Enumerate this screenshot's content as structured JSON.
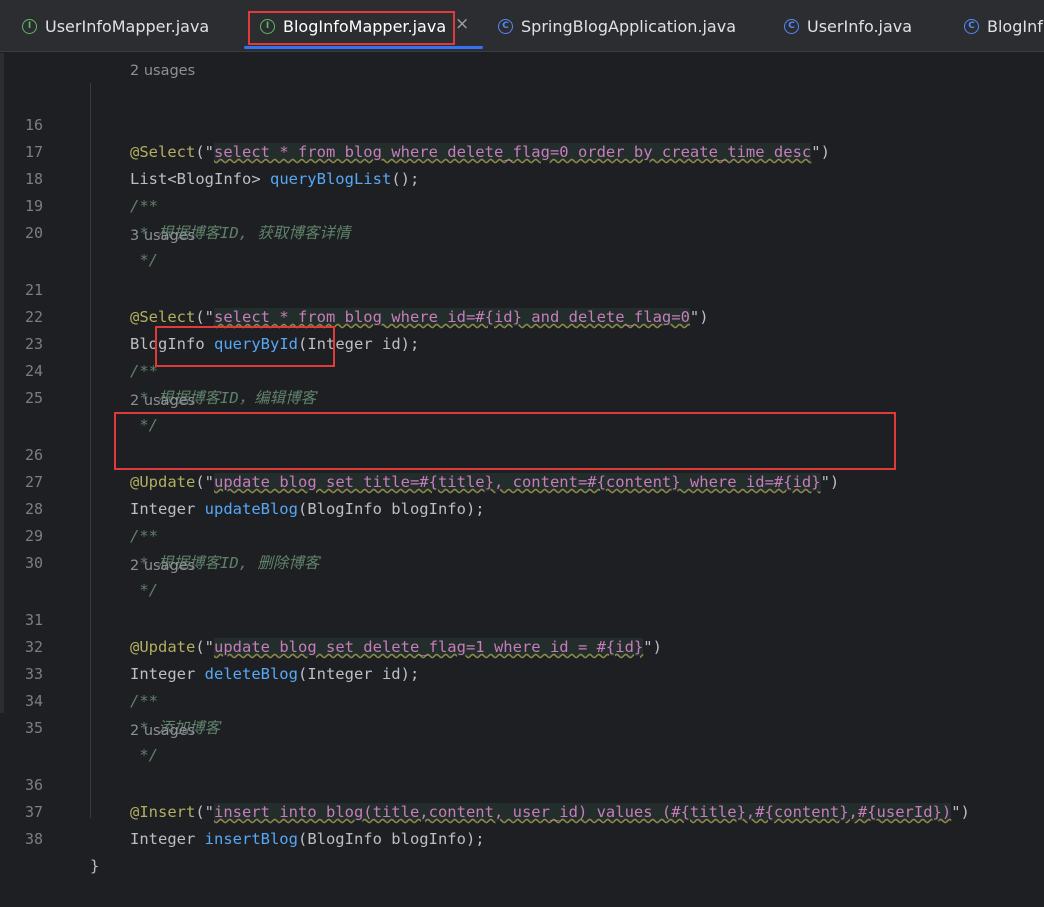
{
  "tabs": [
    {
      "label": "UserInfoMapper.java",
      "icon": "interface-icon",
      "active": false
    },
    {
      "label": "BlogInfoMapper.java",
      "icon": "interface-icon",
      "active": true
    },
    {
      "label": "SpringBlogApplication.java",
      "icon": "spring-class-icon",
      "active": false
    },
    {
      "label": "UserInfo.java",
      "icon": "class-icon",
      "active": false
    },
    {
      "label": "BlogInf",
      "icon": "class-icon",
      "active": false
    }
  ],
  "close_glyph": "×",
  "usages": [
    "2 usages",
    "3 usages",
    "2 usages",
    "2 usages",
    "2 usages"
  ],
  "line_numbers": [
    "16",
    "17",
    "18",
    "19",
    "20",
    "21",
    "22",
    "23",
    "24",
    "25",
    "26",
    "27",
    "28",
    "29",
    "30",
    "31",
    "32",
    "33",
    "34",
    "35",
    "36",
    "37",
    "38"
  ],
  "code": {
    "l16": {
      "ann": "@Select",
      "p1": "(\"",
      "sql": "select * from blog where delete_flag=0 order by create_time desc",
      "p2": "\")"
    },
    "l17": {
      "t1": "List<BlogInfo> ",
      "fn": "queryBlogList",
      "t2": "();"
    },
    "l18": "/**",
    "l19": " * 根据博客ID, 获取博客详情",
    "l20": " */",
    "l21": {
      "ann": "@Select",
      "p1": "(\"",
      "sql": "select * from blog where id=#{id} and delete_flag=0",
      "p2": "\")"
    },
    "l22": {
      "t1": "BlogInfo ",
      "fn": "queryById",
      "t2": "(Integer id);"
    },
    "l23": "/**",
    "l24a": " * ",
    "l24b": "根据博客ID，编辑博客",
    "l25": " */",
    "l26": {
      "ann": "@Update",
      "p1": "(\"",
      "sql": "update blog set title=#{title}, content=#{content} where id=#{id}",
      "p2": "\")"
    },
    "l27": {
      "t1": "Integer ",
      "fn": "updateBlog",
      "t2": "(BlogInfo blogInfo);"
    },
    "l28": "/**",
    "l29": " * 根据博客ID, 删除博客",
    "l30": " */",
    "l31": {
      "ann": "@Update",
      "p1": "(\"",
      "sql": "update blog set delete_flag=1 where id = #{id}",
      "p2": "\")"
    },
    "l32": {
      "t1": "Integer ",
      "fn": "deleteBlog",
      "t2": "(Integer id);"
    },
    "l33": "/**",
    "l34": " * 添加博客",
    "l35": " */",
    "l36": {
      "ann": "@Insert",
      "p1": "(\"",
      "sql": "insert into blog(title,content, user_id) values (#{title},#{content},#{userId})",
      "p2": "\")"
    },
    "l37": {
      "t1": "Integer ",
      "fn": "insertBlog",
      "t2": "(BlogInfo blogInfo);"
    },
    "l38": "}"
  },
  "colors": {
    "highlight_box": "#e03a3a",
    "tab_underline": "#3574f0"
  }
}
